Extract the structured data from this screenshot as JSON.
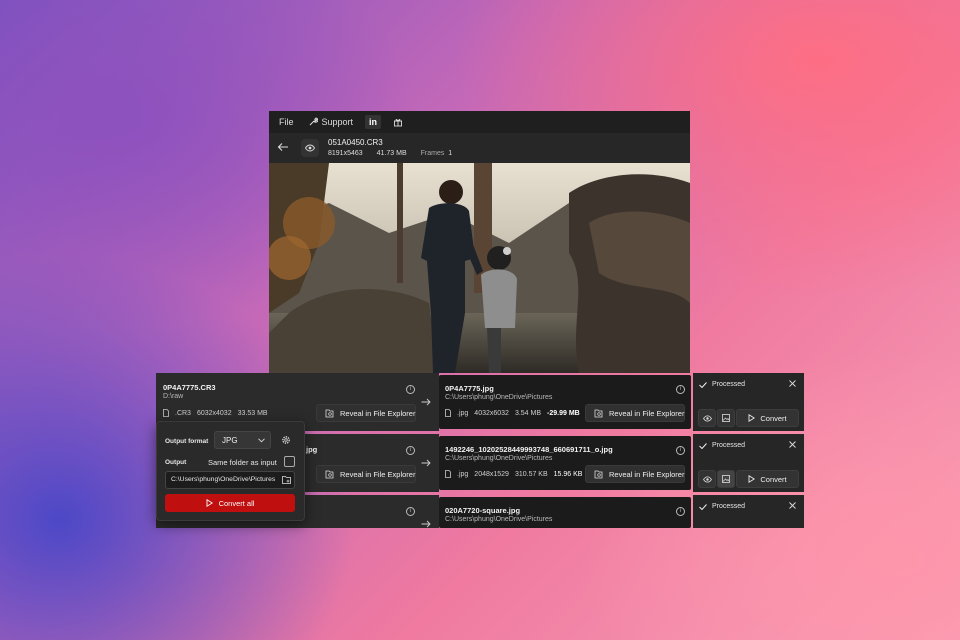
{
  "viewer": {
    "menu": [
      {
        "label": "File",
        "icon": ""
      },
      {
        "label": "Support",
        "icon": "wrench-icon"
      }
    ],
    "linkedin_label": "in",
    "file_name": "051A0450.CR3",
    "resolution": "8191x5463",
    "size": "41.73 MB",
    "frames_label": "Frames",
    "frames_value": "1"
  },
  "rows": [
    {
      "src_name": "0P4A7775.CR3",
      "src_dir": "D:\\raw",
      "src_ext": ".CR3",
      "src_res": "6032x4032",
      "src_size": "33.53 MB",
      "reveal_label": "Reveal in File Explorer",
      "out_name": "0P4A7775.jpg",
      "out_dir": "C:\\Users\\phung\\OneDrive\\Pictures",
      "out_ext": ".jpg",
      "out_res": "4032x6032",
      "out_size": "3.54 MB",
      "out_delta": "-29.99 MB",
      "status": "Processed",
      "convert_label": "Convert"
    },
    {
      "src_name_tail": "jpg",
      "reveal_label": "Reveal in File Explorer",
      "out_name": "1492246_10202528449993748_660691711_o.jpg",
      "out_dir": "C:\\Users\\phung\\OneDrive\\Pictures",
      "out_ext": ".jpg",
      "out_res": "2048x1529",
      "out_size_a": "310.57 KB",
      "out_size_b": "15.96 KB",
      "status": "Processed",
      "convert_label": "Convert"
    },
    {
      "out_name": "020A7720-square.jpg",
      "out_dir": "C:\\Users\\phung\\OneDrive\\Pictures",
      "status": "Processed"
    }
  ],
  "settings": {
    "output_format_label": "Output format",
    "format_value": "JPG",
    "output_label": "Output",
    "same_folder_label": "Same folder as input",
    "output_path": "C:\\Users\\phung\\OneDrive\\Pictures",
    "convert_all_label": "Convert all",
    "accent": "#c00f0f"
  }
}
